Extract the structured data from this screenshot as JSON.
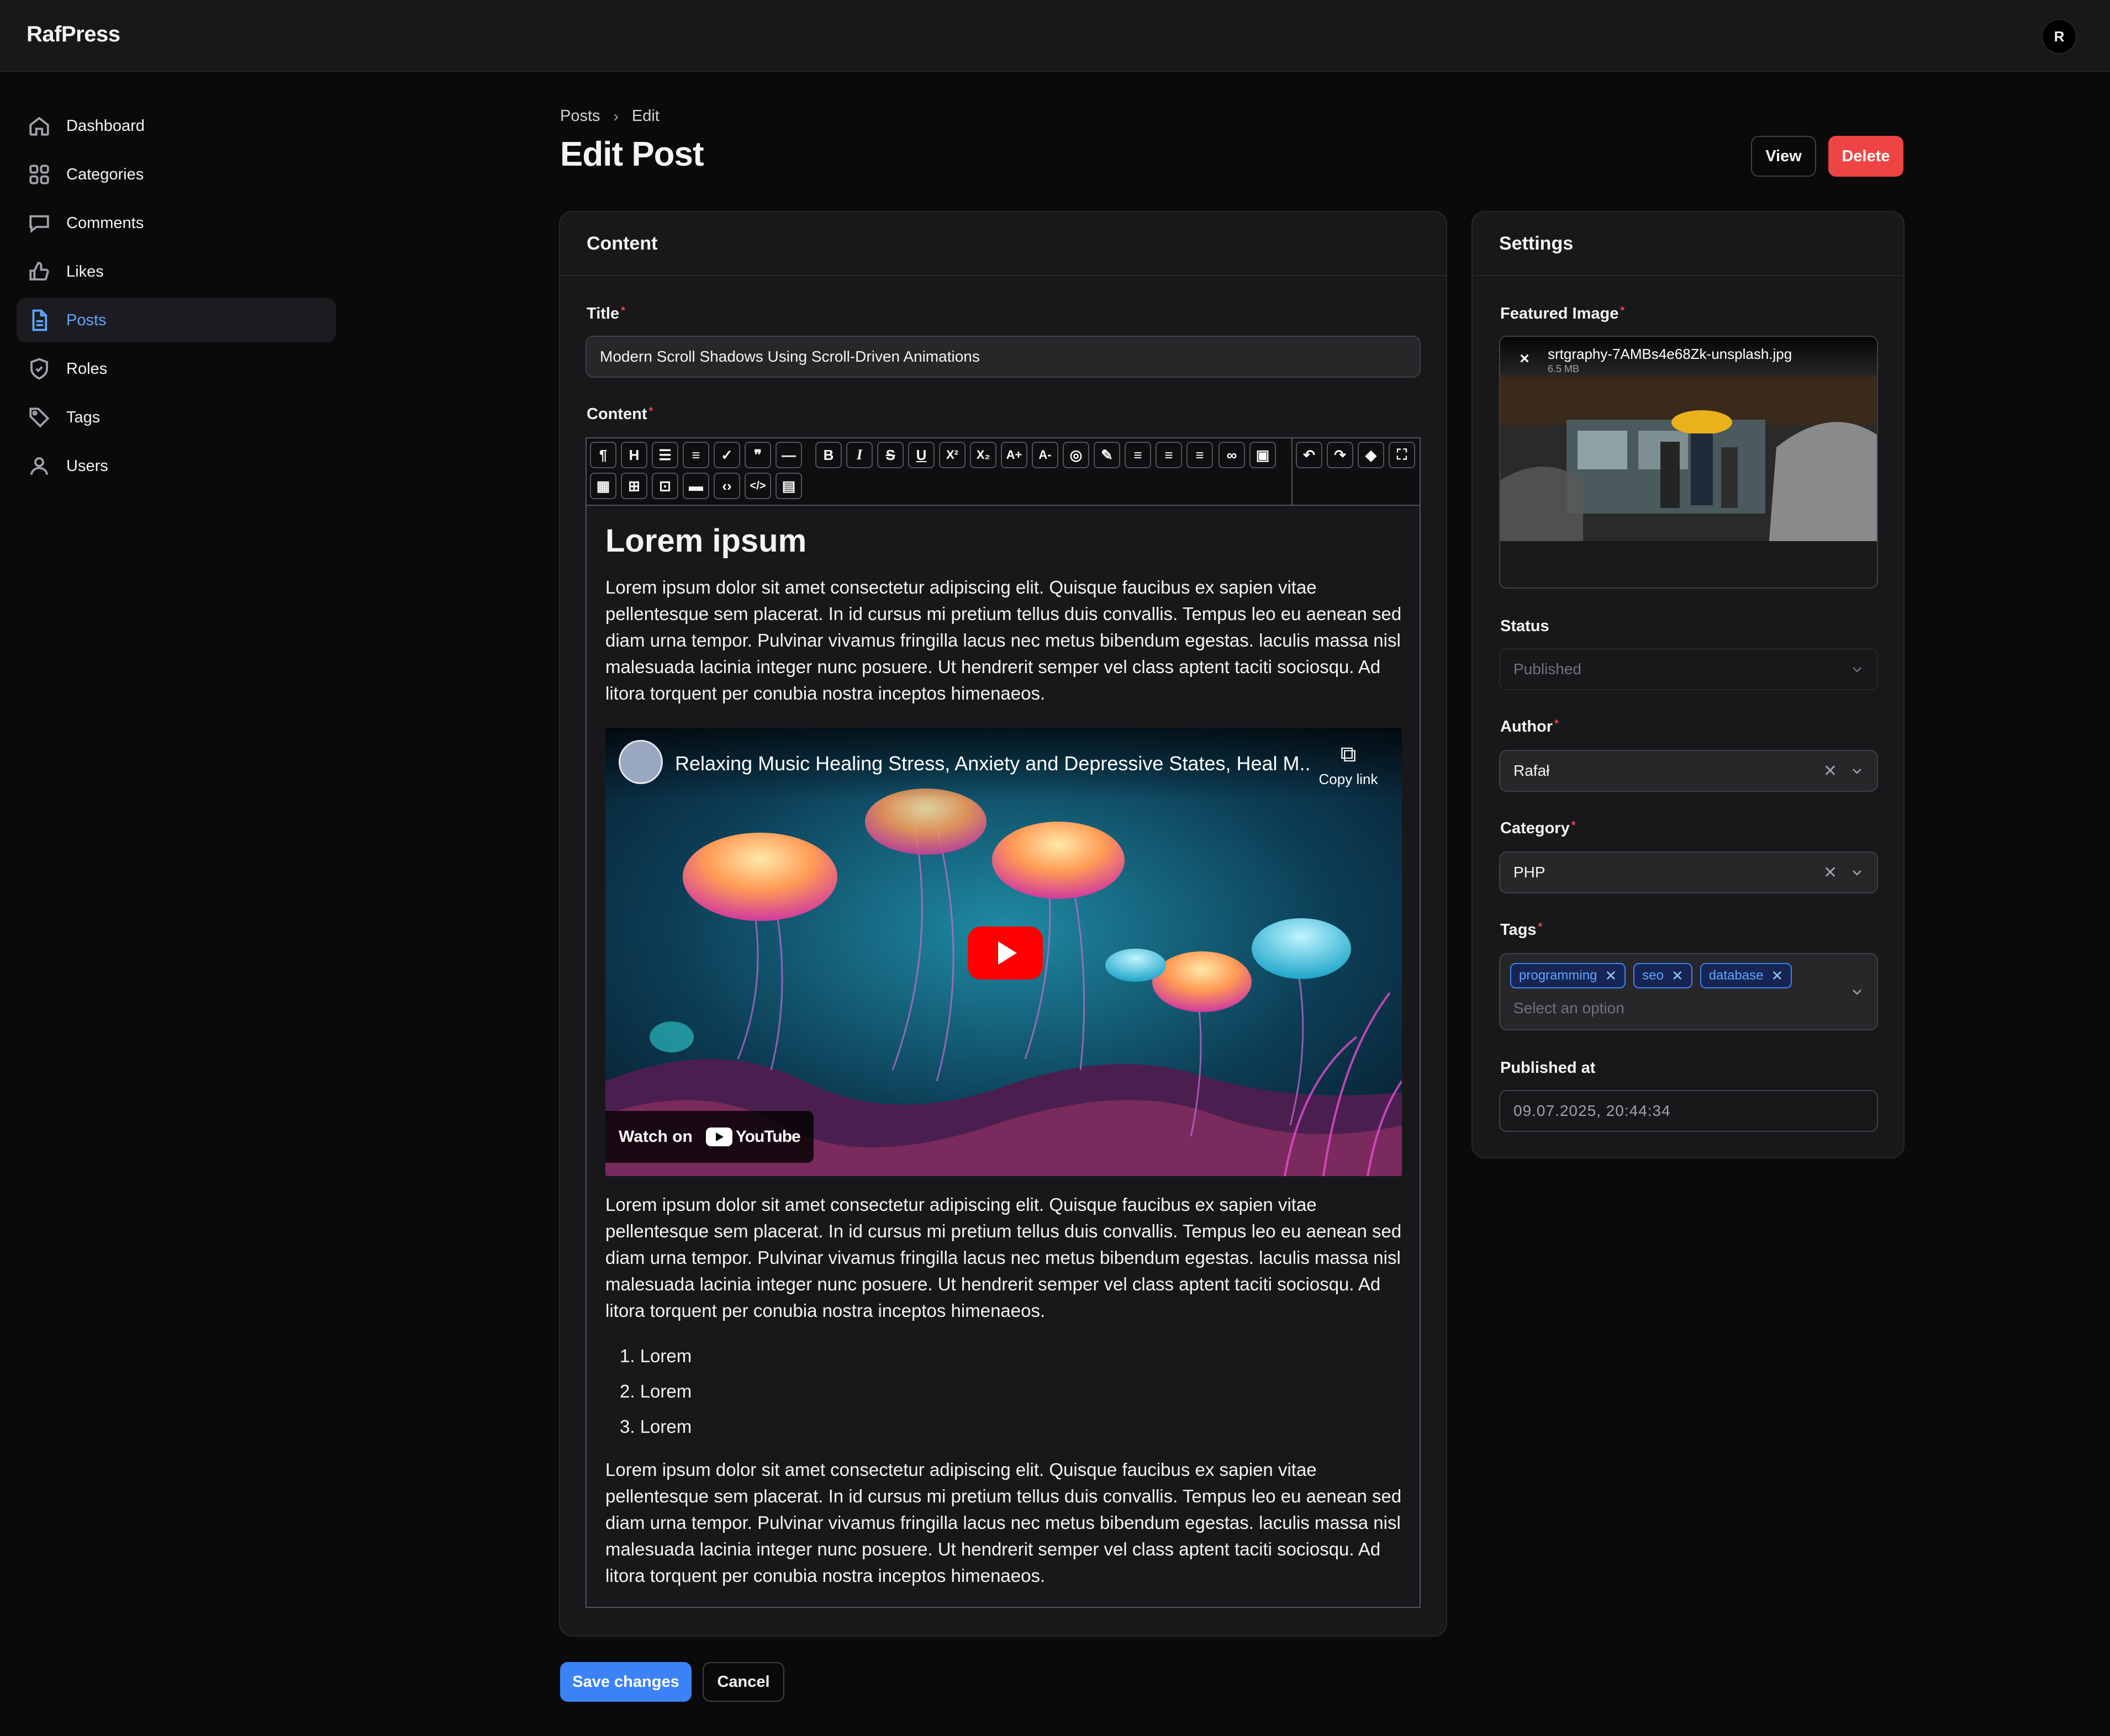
{
  "app": {
    "name": "RafPress",
    "user_initial": "R"
  },
  "sidebar": {
    "items": [
      {
        "label": "Dashboard",
        "icon": "home-icon",
        "active": false
      },
      {
        "label": "Categories",
        "icon": "grid-icon",
        "active": false
      },
      {
        "label": "Comments",
        "icon": "chat-icon",
        "active": false
      },
      {
        "label": "Likes",
        "icon": "thumb-up-icon",
        "active": false
      },
      {
        "label": "Posts",
        "icon": "document-icon",
        "active": true
      },
      {
        "label": "Roles",
        "icon": "shield-icon",
        "active": false
      },
      {
        "label": "Tags",
        "icon": "tag-icon",
        "active": false
      },
      {
        "label": "Users",
        "icon": "user-icon",
        "active": false
      }
    ]
  },
  "breadcrumb": {
    "items": [
      "Posts",
      "Edit"
    ]
  },
  "page": {
    "title": "Edit Post",
    "view_label": "View",
    "delete_label": "Delete"
  },
  "content_card": {
    "title": "Content",
    "title_field": {
      "label": "Title",
      "value": "Modern Scroll Shadows Using Scroll-Driven Animations"
    },
    "content_field": {
      "label": "Content"
    }
  },
  "editor": {
    "heading": "Lorem ipsum",
    "paragraph": "Lorem ipsum dolor sit amet consectetur adipiscing elit. Quisque faucibus ex sapien vitae pellentesque sem placerat. In id cursus mi pretium tellus duis convallis. Tempus leo eu aenean sed diam urna tempor. Pulvinar vivamus fringilla lacus nec metus bibendum egestas. laculis massa nisl malesuada lacinia integer nunc posuere. Ut hendrerit semper vel class aptent taciti sociosqu. Ad litora torquent per conubia nostra inceptos himenaeos.",
    "video": {
      "title": "Relaxing Music Healing Stress, Anxiety and Depressive States, Heal M...",
      "copy_link": "Copy link",
      "watch_on": "Watch on",
      "youtube": "YouTube"
    },
    "list": [
      "Lorem",
      "Lorem",
      "Lorem"
    ]
  },
  "settings_card": {
    "title": "Settings",
    "featured_image": {
      "label": "Featured Image",
      "filename": "srtgraphy-7AMBs4e68Zk-unsplash.jpg",
      "size": "6.5 MB"
    },
    "status": {
      "label": "Status",
      "value": "Published"
    },
    "author": {
      "label": "Author",
      "value": "Rafał"
    },
    "category": {
      "label": "Category",
      "value": "PHP"
    },
    "tags": {
      "label": "Tags",
      "items": [
        "programming",
        "seo",
        "database"
      ],
      "placeholder": "Select an option"
    },
    "published_at": {
      "label": "Published at",
      "value": "09.07.2025, 20:44:34"
    }
  },
  "actions": {
    "save_label": "Save changes",
    "cancel_label": "Cancel"
  }
}
